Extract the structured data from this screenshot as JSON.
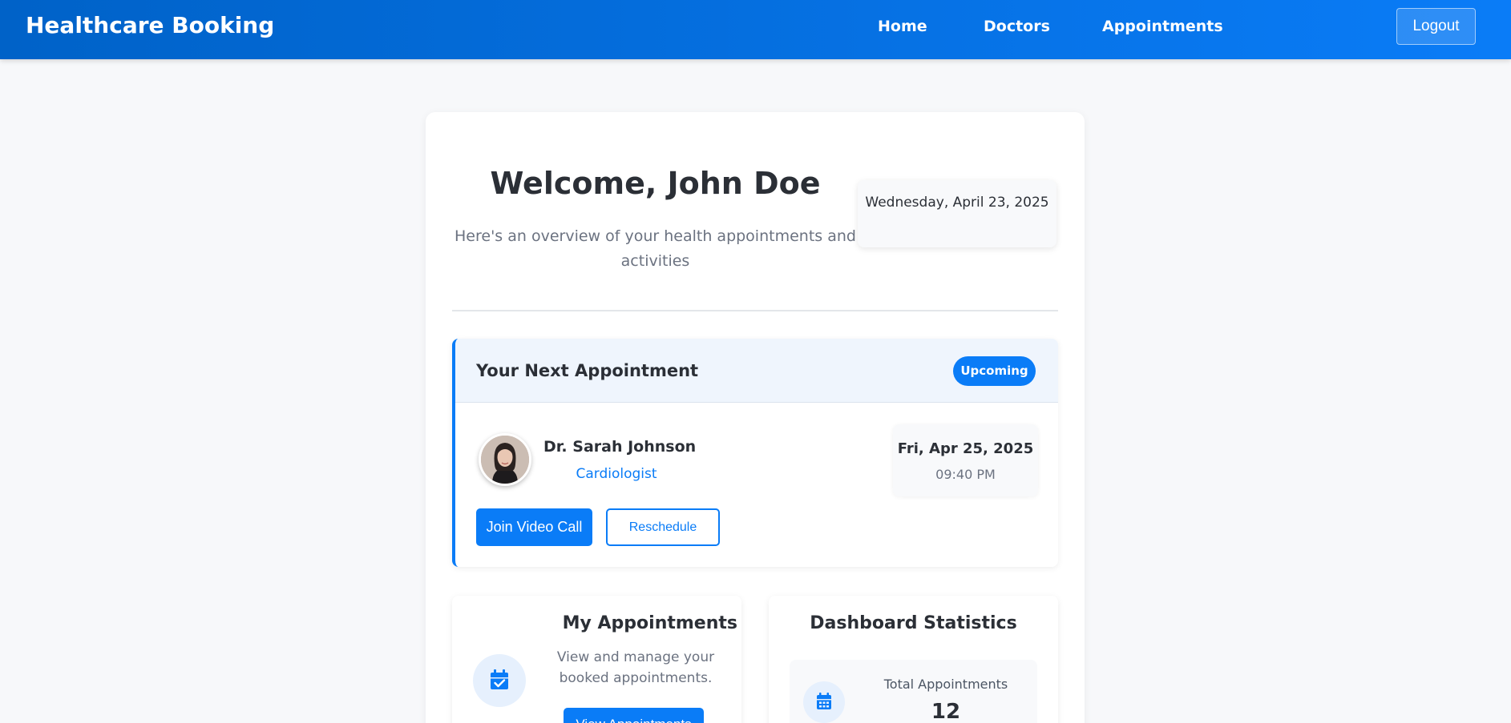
{
  "navbar": {
    "brand": "Healthcare Booking",
    "links": [
      "Home",
      "Doctors",
      "Appointments"
    ],
    "logout_label": "Logout"
  },
  "welcome": {
    "title": "Welcome, John Doe",
    "subtitle": "Here's an overview of your health appointments and activities",
    "date": "Wednesday, April 23, 2025"
  },
  "next_appointment": {
    "heading": "Your Next Appointment",
    "status": "Upcoming",
    "doctor_name": "Dr. Sarah Johnson",
    "specialty": "Cardiologist",
    "date": "Fri, Apr 25, 2025",
    "time": "09:40 PM",
    "join_label": "Join Video Call",
    "reschedule_label": "Reschedule"
  },
  "my_appointments": {
    "title": "My Appointments",
    "description": "View and manage your booked appointments.",
    "button_label": "View Appointments",
    "icon": "calendar-check-icon"
  },
  "statistics": {
    "title": "Dashboard Statistics",
    "total_label": "Total Appointments",
    "total_value": "12",
    "icon": "calendar-icon"
  },
  "colors": {
    "primary": "#0a7cf7",
    "nav_start": "#0062c8",
    "background": "#f7f8fa"
  }
}
